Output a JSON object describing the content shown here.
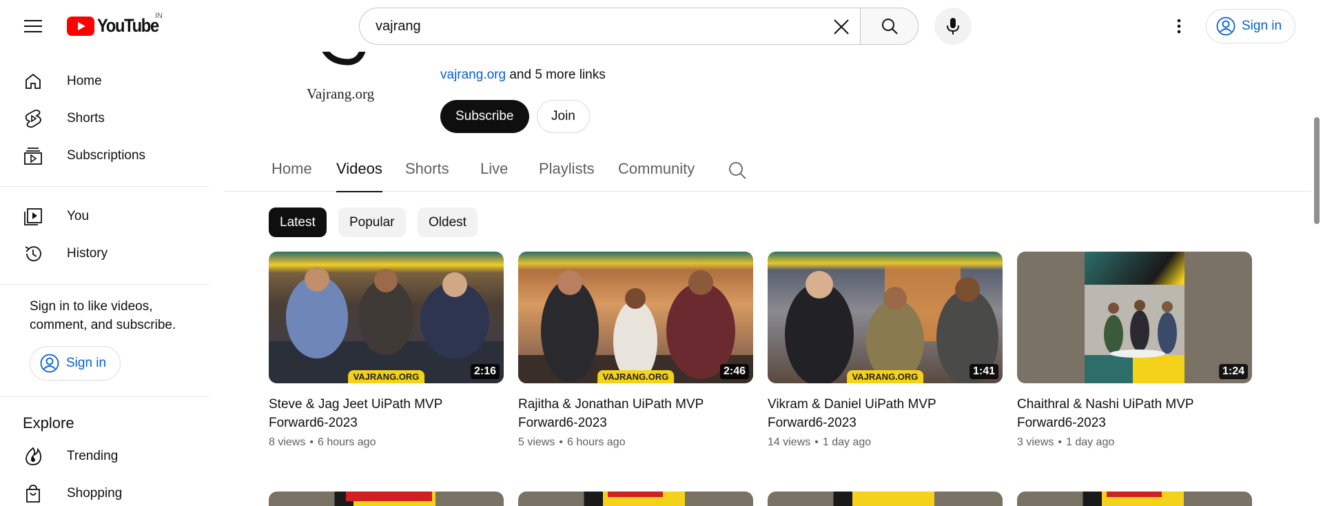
{
  "header": {
    "country": "IN",
    "search_value": "vajrang",
    "signin_label": "Sign in"
  },
  "sidebar": {
    "items": [
      {
        "label": "Home",
        "icon": "home-icon"
      },
      {
        "label": "Shorts",
        "icon": "shorts-icon"
      },
      {
        "label": "Subscriptions",
        "icon": "subscriptions-icon"
      },
      {
        "label": "You",
        "icon": "you-icon"
      },
      {
        "label": "History",
        "icon": "history-icon"
      }
    ],
    "signin_prompt": "Sign in to like videos, comment, and subscribe.",
    "signin_label": "Sign in",
    "explore_title": "Explore",
    "explore_items": [
      {
        "label": "Trending",
        "icon": "trending-icon"
      },
      {
        "label": "Shopping",
        "icon": "shopping-icon"
      }
    ]
  },
  "channel": {
    "logo_text": "Vajrang.org",
    "link": "vajrang.org",
    "more_links": "and 5 more links",
    "subscribe_label": "Subscribe",
    "join_label": "Join"
  },
  "tabs": [
    "Home",
    "Videos",
    "Shorts",
    "Live",
    "Playlists",
    "Community"
  ],
  "active_tab": "Videos",
  "chips": [
    "Latest",
    "Popular",
    "Oldest"
  ],
  "active_chip": "Latest",
  "videos": [
    {
      "title": "Steve & Jag Jeet UiPath MVP Forward6-2023",
      "duration": "2:16",
      "views": "8 views",
      "age": "6 hours ago",
      "watermark": "VAJRANG.ORG"
    },
    {
      "title": "Rajitha & Jonathan UiPath MVP Forward6-2023",
      "duration": "2:46",
      "views": "5 views",
      "age": "6 hours ago",
      "watermark": "VAJRANG.ORG"
    },
    {
      "title": "Vikram & Daniel UiPath MVP Forward6-2023",
      "duration": "1:41",
      "views": "14 views",
      "age": "1 day ago",
      "watermark": "VAJRANG.ORG"
    },
    {
      "title": "Chaithral & Nashi UiPath MVP Forward6-2023",
      "duration": "1:24",
      "views": "3 views",
      "age": "1 day ago",
      "watermark": ""
    }
  ],
  "colors": {
    "link_blue": "#065fd4",
    "brand_red": "#ff0000",
    "thumb_yellow": "#f4d21a",
    "thumb_teal": "#2d6e6a"
  }
}
